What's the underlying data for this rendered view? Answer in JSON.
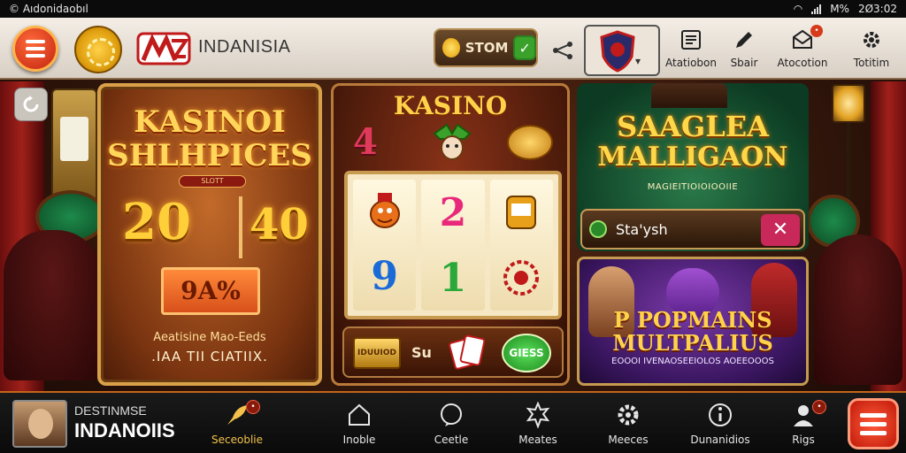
{
  "status_bar": {
    "left_text": "© Aıdonidaobıl",
    "battery": "M%",
    "time": "2Ø3:02"
  },
  "top_bar": {
    "brand_name": "INDANISIA",
    "storm_label": "STOM",
    "tools": [
      {
        "label": "Atatiobon",
        "icon": "article-icon"
      },
      {
        "label": "Sbair",
        "icon": "pen-icon"
      },
      {
        "label": "Atocotion",
        "icon": "mail-icon"
      },
      {
        "label": "Totitim",
        "icon": "gear-icon"
      }
    ]
  },
  "panels": {
    "left": {
      "title1": "KASINOI",
      "title2": "SHLHPICES",
      "ribbon": "SLOTT",
      "num1": "20",
      "num2": "40",
      "percent": "9A%",
      "line1": "Aeatisine Mao-Eeds",
      "line2": ".IAA TII CIATIIX."
    },
    "center": {
      "title": "KASINO",
      "corner_num": "4",
      "reels": {
        "r1": [
          "",
          "9"
        ],
        "r2": [
          "2",
          "1"
        ],
        "r3": [
          "",
          ""
        ]
      },
      "chest_label": "IDUUIOD",
      "six_label": "Su",
      "go_label": "GIESS"
    },
    "right_top": {
      "title1": "SAAGLEA",
      "title2": "MALLIGAON",
      "subtitle": "MAGIEITIOIOIOOIIE",
      "search_text": "Sta'ysh"
    },
    "right_bottom": {
      "title1": "P POPMAINS",
      "title2": "MULTPALIUS",
      "subtitle": "EOOOI IVENAOSEEIOLOS AOEEOOOS"
    }
  },
  "bottom_nav": {
    "user_name": "DESTINMSE",
    "user_handle": "INDANOIIS",
    "items": [
      {
        "label": "Seceoblie",
        "icon": "rocket-icon",
        "active": true
      },
      {
        "label": "Inoble",
        "icon": "home-icon",
        "active": false
      },
      {
        "label": "Ceetle",
        "icon": "chat-icon",
        "active": false
      },
      {
        "label": "Meates",
        "icon": "badge-icon",
        "active": false
      },
      {
        "label": "Meeces",
        "icon": "settings-icon",
        "active": false
      },
      {
        "label": "Dunanidios",
        "icon": "info-icon",
        "active": false
      },
      {
        "label": "Rigs",
        "icon": "user-icon",
        "active": false
      }
    ]
  },
  "colors": {
    "accent": "#c2661a",
    "gold": "#ffd24a",
    "danger": "#c8285a",
    "ok": "#3aa12a"
  }
}
